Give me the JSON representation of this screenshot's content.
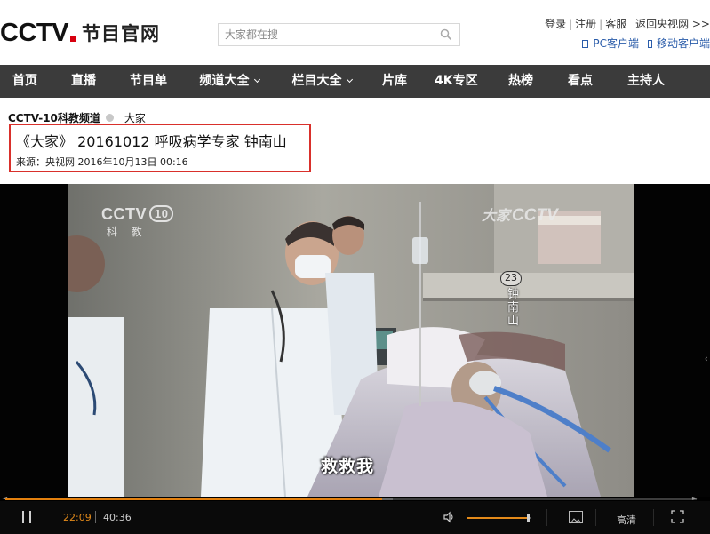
{
  "header": {
    "logo_text": "CCTV",
    "logo_sub": "节目官网",
    "search_placeholder": "大家都在搜",
    "links": [
      "登录",
      "注册",
      "客服",
      "返回央视网 >>"
    ],
    "client_links": [
      "PC客户端",
      "移动客户端"
    ]
  },
  "nav": {
    "items": [
      {
        "label": "首页",
        "dropdown": false
      },
      {
        "label": "直播",
        "dropdown": false
      },
      {
        "label": "节目单",
        "dropdown": false
      },
      {
        "label": "频道大全",
        "dropdown": true
      },
      {
        "label": "栏目大全",
        "dropdown": true
      },
      {
        "label": "片库",
        "dropdown": false
      },
      {
        "label": "4K专区",
        "dropdown": false
      },
      {
        "label": "热榜",
        "dropdown": false
      },
      {
        "label": "看点",
        "dropdown": false
      },
      {
        "label": "主持人",
        "dropdown": false
      }
    ]
  },
  "breadcrumb": {
    "channel": "CCTV-10科教频道",
    "program": "大家"
  },
  "video": {
    "title": "《大家》 20161012 呼吸病学专家 钟南山",
    "source": "来源：央视网 2016年10月13日 00:16",
    "subtitle": "救救我",
    "watermark_channel": "CCTV",
    "watermark_channel_no": "10",
    "watermark_channel_name": "科 教",
    "watermark_program": "大家",
    "watermark_program_logo": "CCTV",
    "name_badge": "23",
    "name_text": "钟南山"
  },
  "player": {
    "current_time": "22:09",
    "total_time": "40:36",
    "progress_fraction": 0.545,
    "buffer_fraction": 0.56,
    "volume_fraction": 0.97,
    "quality_label": "高清",
    "accent_color": "#e3800e"
  }
}
